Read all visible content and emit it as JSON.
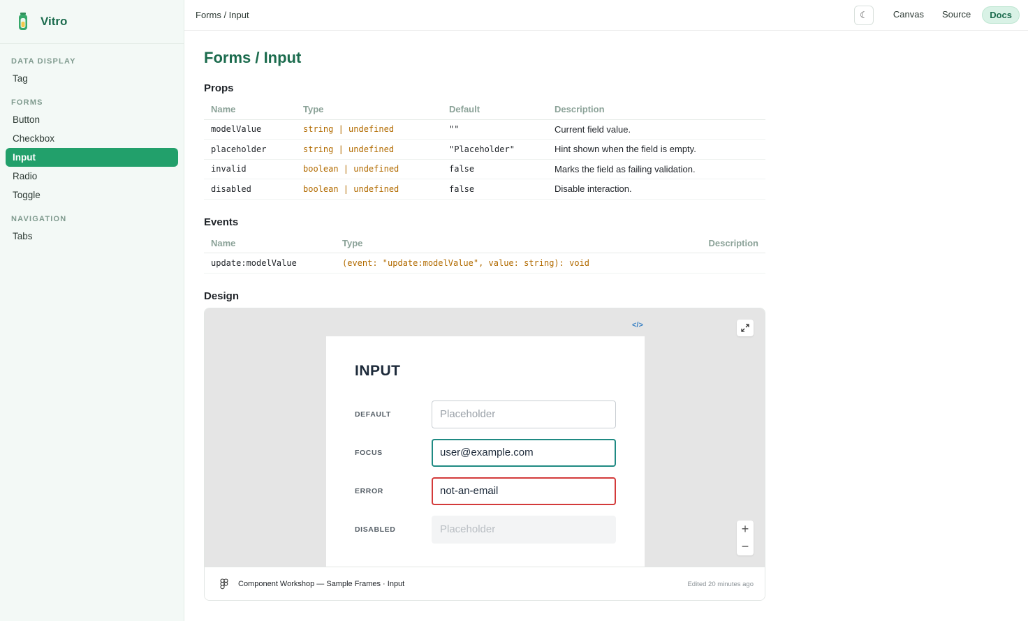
{
  "brand": {
    "name": "Vitro"
  },
  "sidebar": {
    "sections": [
      {
        "title": "DATA DISPLAY",
        "items": [
          "Tag"
        ]
      },
      {
        "title": "FORMS",
        "items": [
          "Button",
          "Checkbox",
          "Input",
          "Radio",
          "Toggle"
        ]
      },
      {
        "title": "NAVIGATION",
        "items": [
          "Tabs"
        ]
      }
    ],
    "active_item": "Input"
  },
  "topbar": {
    "breadcrumb": "Forms / Input",
    "theme_icon": "moon-icon",
    "theme_glyph": "☾",
    "links": [
      "Canvas",
      "Source",
      "Docs"
    ],
    "active_link": "Docs"
  },
  "page": {
    "title": "Forms / Input"
  },
  "props": {
    "title": "Props",
    "columns": [
      "Name",
      "Type",
      "Default",
      "Description"
    ],
    "rows": [
      {
        "name": "modelValue",
        "type": "string | undefined",
        "default": "\"\"",
        "description": "Current field value."
      },
      {
        "name": "placeholder",
        "type": "string | undefined",
        "default": "\"Placeholder\"",
        "description": "Hint shown when the field is empty."
      },
      {
        "name": "invalid",
        "type": "boolean | undefined",
        "default": "false",
        "description": "Marks the field as failing validation."
      },
      {
        "name": "disabled",
        "type": "boolean | undefined",
        "default": "false",
        "description": "Disable interaction."
      }
    ]
  },
  "events": {
    "title": "Events",
    "columns": [
      "Name",
      "Type",
      "Description"
    ],
    "rows": [
      {
        "name": "update:modelValue",
        "type": "(event: \"update:modelValue\", value: string): void",
        "description": ""
      }
    ]
  },
  "design": {
    "title": "Design",
    "code_toggle": "</>",
    "frame": {
      "title": "INPUT",
      "rows": [
        {
          "label": "DEFAULT",
          "value": "Placeholder",
          "state": "default"
        },
        {
          "label": "FOCUS",
          "value": "user@example.com",
          "state": "focus"
        },
        {
          "label": "ERROR",
          "value": "not-an-email",
          "state": "error"
        },
        {
          "label": "DISABLED",
          "value": "Placeholder",
          "state": "disabled"
        }
      ]
    },
    "zoom_in": "+",
    "zoom_out": "−",
    "footer": {
      "source": "Component Workshop — Sample Frames · Input",
      "edited": "Edited 20 minutes ago"
    }
  },
  "colors": {
    "accent": "#22a06b",
    "brand_text": "#1b6b4d",
    "type_text": "#b26b00",
    "focus_border": "#1f8a83",
    "error_border": "#d33a3a"
  }
}
